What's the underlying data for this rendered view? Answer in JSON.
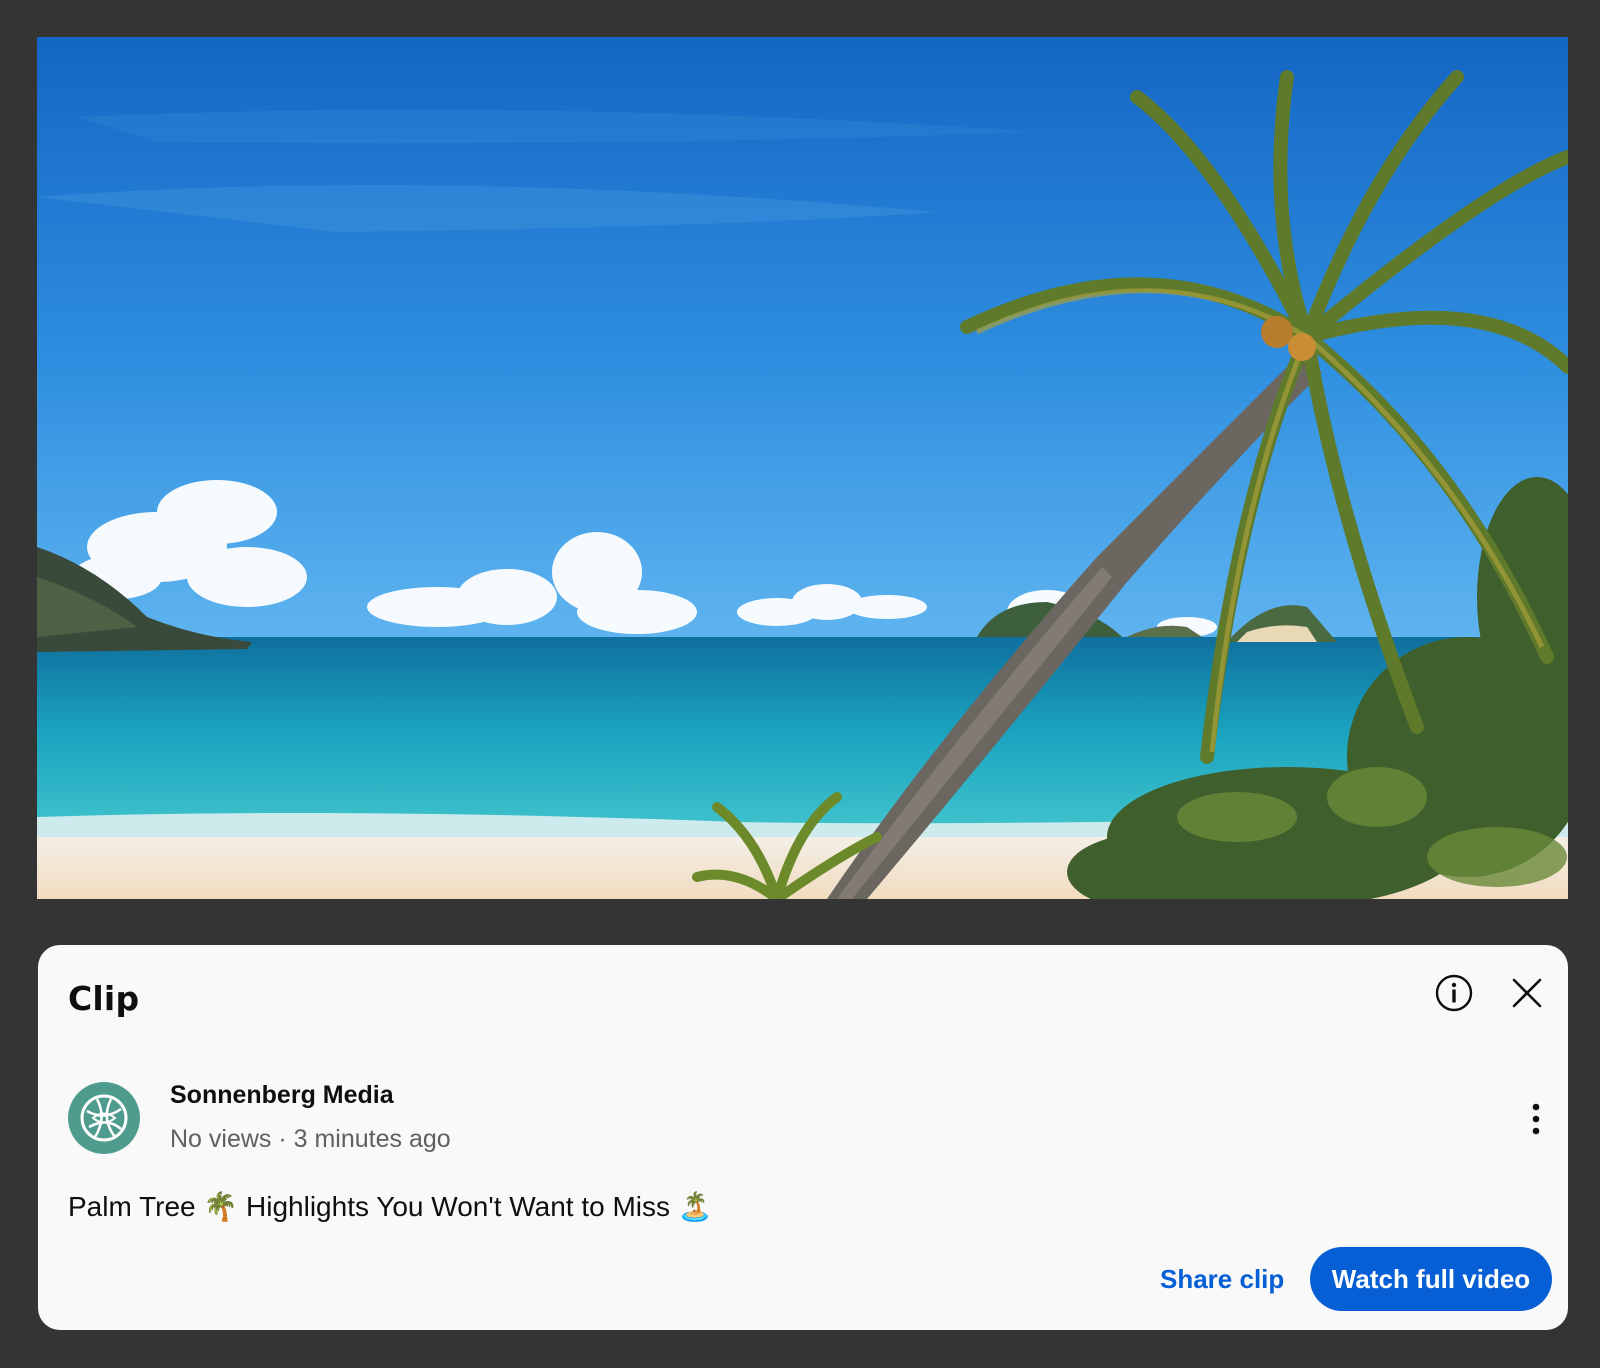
{
  "video": {
    "scene": "beach-palm-tree-frame"
  },
  "clip_panel": {
    "title": "Clip",
    "info_icon": "info-circle-icon",
    "close_icon": "close-icon"
  },
  "channel": {
    "name": "Sonnenberg Media",
    "avatar_icon": "globe-leaf-icon",
    "avatar_color": "#4f9c8f",
    "meta": "No views · 3 minutes ago",
    "more_icon": "more-vertical-icon"
  },
  "clip": {
    "title": "Palm Tree 🌴 Highlights You Won't Want to Miss 🏝️"
  },
  "actions": {
    "share_label": "Share clip",
    "watch_label": "Watch full video",
    "accent_color": "#065fd4"
  }
}
